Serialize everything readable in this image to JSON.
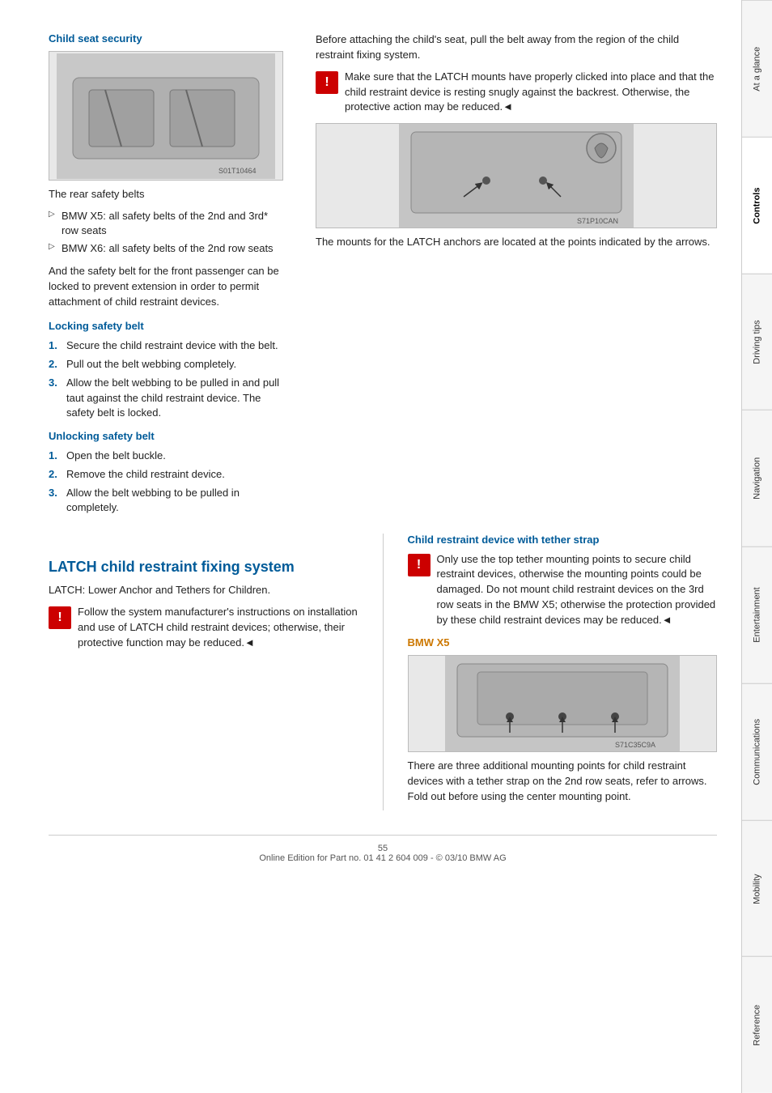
{
  "page": {
    "number": "55",
    "footer": "Online Edition for Part no. 01 41 2 604 009 - © 03/10 BMW AG"
  },
  "sidebar": {
    "tabs": [
      {
        "label": "At a glance",
        "active": false
      },
      {
        "label": "Controls",
        "active": true
      },
      {
        "label": "Driving tips",
        "active": false
      },
      {
        "label": "Navigation",
        "active": false
      },
      {
        "label": "Entertainment",
        "active": false
      },
      {
        "label": "Communications",
        "active": false
      },
      {
        "label": "Mobility",
        "active": false
      },
      {
        "label": "Reference",
        "active": false
      }
    ]
  },
  "child_seat_security": {
    "title": "Child seat security",
    "image_alt": "Rear safety belts diagram",
    "image_code": "S01T10464",
    "caption": "The rear safety belts",
    "bullets": [
      "BMW X5: all safety belts of the 2nd and 3rd* row seats",
      "BMW X6: all safety belts of the 2nd row seats"
    ],
    "paragraph": "And the safety belt for the front passenger can be locked to prevent extension in order to permit attachment of child restraint devices.",
    "locking_safety_belt": {
      "title": "Locking safety belt",
      "steps": [
        "Secure the child restraint device with the belt.",
        "Pull out the belt webbing completely.",
        "Allow the belt webbing to be pulled in and pull taut against the child restraint device. The safety belt is locked."
      ]
    },
    "unlocking_safety_belt": {
      "title": "Unlocking safety belt",
      "steps": [
        "Open the belt buckle.",
        "Remove the child restraint device.",
        "Allow the belt webbing to be pulled in completely."
      ]
    }
  },
  "latch_system": {
    "title": "LATCH child restraint fixing system",
    "intro": "LATCH: Lower Anchor and Tethers for Children.",
    "warning1": "Follow the system manufacturer's instructions on installation and use of LATCH child restraint devices; otherwise, their protective function may be reduced.◄",
    "right_col": {
      "paragraph1": "Before attaching the child's seat, pull the belt away from the region of the child restraint fixing system.",
      "warning2": "Make sure that the LATCH mounts have properly clicked into place and that the child restraint device is resting snugly against the backrest. Otherwise, the protective action may be reduced.◄",
      "image_alt": "LATCH anchor illustration",
      "image_code": "S71P10CAN",
      "caption": "The mounts for the LATCH anchors are located at the points indicated by the arrows."
    },
    "tether_strap": {
      "title": "Child restraint device with tether strap",
      "warning": "Only use the top tether mounting points to secure child restraint devices, otherwise the mounting points could be damaged. Do not mount child restraint devices on the 3rd row seats in the BMW X5; otherwise the protection provided by these child restraint devices may be reduced.◄"
    },
    "bmw_x5": {
      "title": "BMW X5",
      "image_alt": "BMW X5 mounting points",
      "image_code": "S71C35C9A",
      "caption": "There are three additional mounting points for child restraint devices with a tether strap on the 2nd row seats, refer to arrows. Fold out before using the center mounting point."
    }
  }
}
